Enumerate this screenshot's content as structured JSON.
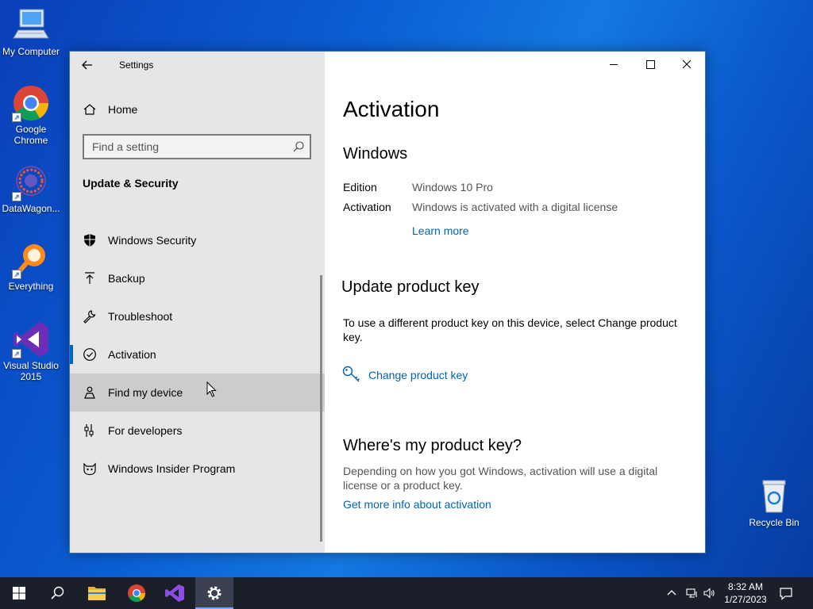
{
  "desktop": {
    "icons": [
      {
        "label": "My Computer"
      },
      {
        "label": "Google Chrome"
      },
      {
        "label": "DataWagon..."
      },
      {
        "label": "Everything"
      },
      {
        "label": "Visual Studio 2015"
      },
      {
        "label": "Recycle Bin"
      }
    ]
  },
  "window": {
    "title": "Settings",
    "sidebar": {
      "home_label": "Home",
      "search_placeholder": "Find a setting",
      "section_title": "Update & Security",
      "items": [
        {
          "label": "Windows Security",
          "icon": "shield-icon"
        },
        {
          "label": "Backup",
          "icon": "backup-arrow-icon"
        },
        {
          "label": "Troubleshoot",
          "icon": "wrench-icon"
        },
        {
          "label": "Activation",
          "icon": "check-circle-icon",
          "selected": true
        },
        {
          "label": "Find my device",
          "icon": "person-location-icon",
          "hover": true
        },
        {
          "label": "For developers",
          "icon": "developer-tools-icon"
        },
        {
          "label": "Windows Insider Program",
          "icon": "insider-cat-icon"
        }
      ]
    },
    "content": {
      "page_title": "Activation",
      "windows_heading": "Windows",
      "edition_key": "Edition",
      "edition_value": "Windows 10 Pro",
      "activation_key": "Activation",
      "activation_value": "Windows is activated with a digital license",
      "learn_more": "Learn more",
      "update_heading": "Update product key",
      "update_text": "To use a different product key on this device, select Change product key.",
      "change_key_link": "Change product key",
      "where_heading": "Where's my product key?",
      "where_text": "Depending on how you got Windows, activation will use a digital license or a product key.",
      "more_info_link": "Get more info about activation"
    }
  },
  "taskbar": {
    "time": "8:32 AM",
    "date": "1/27/2023"
  },
  "colors": {
    "accent": "#0067c0",
    "link": "#0063b1",
    "sidebar_bg": "#e6e6e6",
    "taskbar_bg": "#1b1f29"
  }
}
